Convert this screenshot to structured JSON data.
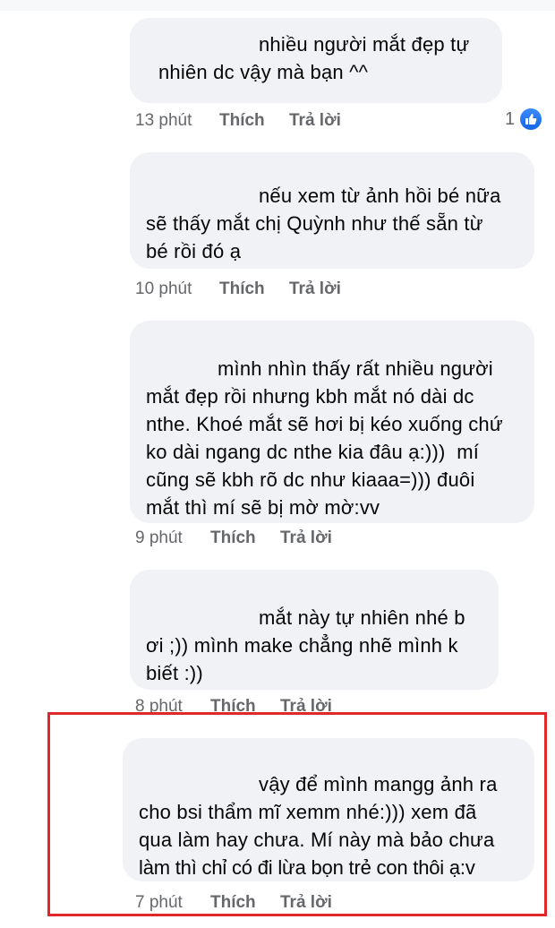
{
  "comments": [
    {
      "lines": [
        "nhiều người mắt đẹp tự",
        "nhiên dc vậy mà bạn ^^"
      ],
      "time": "13 phút",
      "like": "Thích",
      "reply": "Trả lời",
      "reaction_count": "1"
    },
    {
      "lines": [
        "nếu xem từ ảnh hồi bé nữa",
        "sẽ thấy mắt chị Quỳnh như thế sẵn từ",
        "bé rồi đó ạ"
      ],
      "time": "10 phút",
      "like": "Thích",
      "reply": "Trả lời"
    },
    {
      "lines": [
        "mình nhìn thấy rất nhiều người",
        "mắt đẹp rồi nhưng kbh mắt nó dài dc",
        "nthe. Khoé mắt sẽ hơi bị kéo xuống chứ",
        "ko dài ngang dc nthe kia đâu ạ:)))  mí",
        "cũng sẽ kbh rõ dc như kiaaa=))) đuôi",
        "mắt thì mí sẽ bị mờ mờ:vv"
      ],
      "time": "9 phút",
      "like": "Thích",
      "reply": "Trả lời"
    },
    {
      "lines": [
        "mắt này tự nhiên nhé b",
        "ơi ;)) mình make chẳng nhẽ mình k",
        "biết :))"
      ],
      "time": "8 phút",
      "like": "Thích",
      "reply": "Trả lời"
    },
    {
      "lines": [
        "vậy để mình mangg ảnh ra",
        "cho bsi thẩm mĩ xemm nhé:))) xem đã",
        "qua làm hay chưa. Mí này mà bảo chưa",
        "làm thì chỉ có đi lừa bọn trẻ con thôi ạ:v"
      ],
      "time": "7 phút",
      "like": "Thích",
      "reply": "Trả lời"
    }
  ],
  "colors": {
    "bubble": "#f0f2f5",
    "meta": "#65676b",
    "highlight": "#e0282b",
    "like": "#1877f2"
  }
}
